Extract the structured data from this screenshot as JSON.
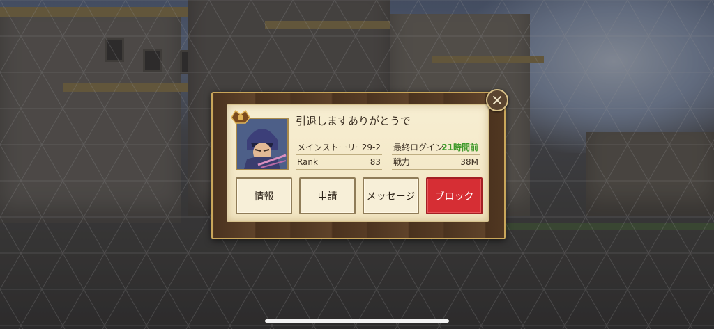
{
  "player": {
    "name": "引退しますありがとうで"
  },
  "stats": {
    "main_story_label": "メインストーリー",
    "main_story_value": "29-2",
    "last_login_label": "最終ログイン",
    "last_login_value": "21時間前",
    "rank_label": "Rank",
    "rank_value": "83",
    "power_label": "戦力",
    "power_value": "38M"
  },
  "buttons": {
    "info": "情報",
    "request": "申請",
    "message": "メッセージ",
    "block": "ブロック"
  },
  "colors": {
    "block_button": "#d62e34",
    "last_login_value": "#3f9a2a",
    "dialog_frame": "#c9a65a"
  },
  "icons": [
    "close-icon",
    "rank-badge-icon",
    "player-avatar"
  ]
}
